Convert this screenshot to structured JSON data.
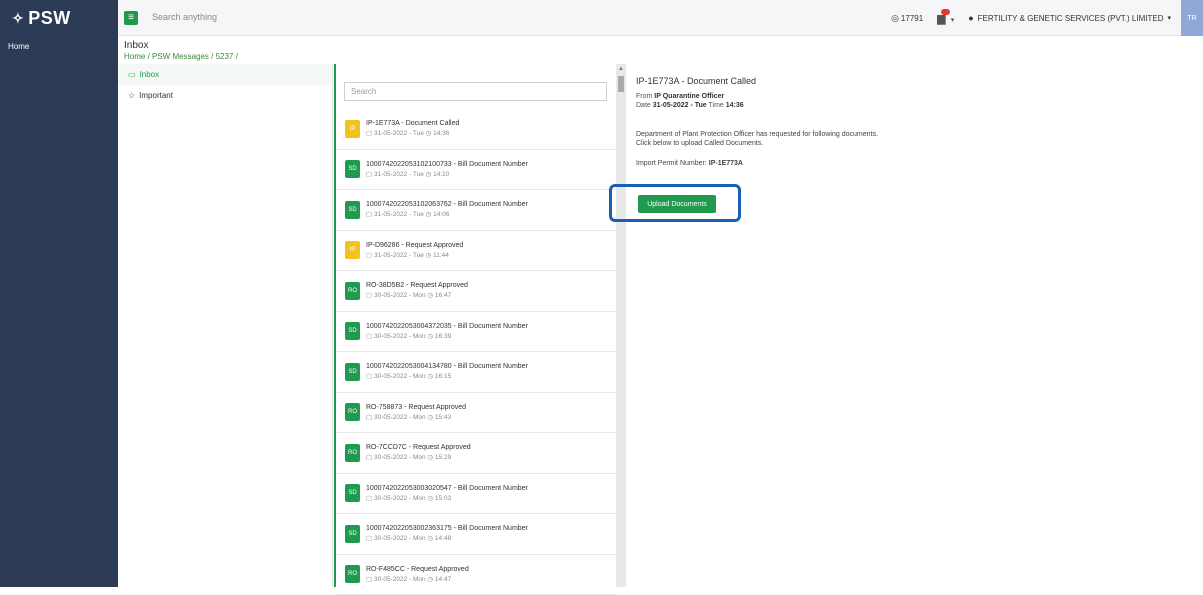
{
  "app": {
    "logo": "PSW",
    "logo_mark": "✧"
  },
  "topbar": {
    "search_placeholder": "Search anything",
    "counter": "17791",
    "company": "FERTILITY & GENETIC SERVICES (PVT.) LIMITED",
    "avatar": "TR"
  },
  "sidebar": {
    "home": "Home"
  },
  "header": {
    "title": "Inbox",
    "breadcrumb": "Home / PSW Messages / 5237 /"
  },
  "nav": [
    {
      "label": "Inbox",
      "icon": "inbox-icon"
    },
    {
      "label": "Important",
      "icon": "star-icon"
    }
  ],
  "messages_search_placeholder": "Search",
  "messages": [
    {
      "badge": "IP",
      "title": "IP-1E773A - Document Called",
      "date": "31-05-2022 - Tue",
      "time": "14:36"
    },
    {
      "badge": "SD",
      "title": "1000742022053102100733 - Bill Document Number",
      "date": "31-05-2022 - Tue",
      "time": "14:10"
    },
    {
      "badge": "SD",
      "title": "1000742022053102063762 - Bill Document Number",
      "date": "31-05-2022 - Tue",
      "time": "14:06"
    },
    {
      "badge": "IP",
      "title": "IP-D96286 - Request Approved",
      "date": "31-05-2022 - Tue",
      "time": "11:44"
    },
    {
      "badge": "RO",
      "title": "RO-38D5B2 - Request Approved",
      "date": "30-05-2022 - Mon",
      "time": "16:47"
    },
    {
      "badge": "SD",
      "title": "1000742022053004372035 - Bill Document Number",
      "date": "30-05-2022 - Mon",
      "time": "16:39"
    },
    {
      "badge": "SD",
      "title": "1000742022053004134780 - Bill Document Number",
      "date": "30-05-2022 - Mon",
      "time": "16:15"
    },
    {
      "badge": "RO",
      "title": "RO-758873 - Request Approved",
      "date": "30-05-2022 - Mon",
      "time": "15:43"
    },
    {
      "badge": "RO",
      "title": "RO-7CCD7C - Request Approved",
      "date": "30-05-2022 - Mon",
      "time": "15:29"
    },
    {
      "badge": "SD",
      "title": "1000742022053003020547 - Bill Document Number",
      "date": "30-05-2022 - Mon",
      "time": "15:03"
    },
    {
      "badge": "SD",
      "title": "1000742022053002363175 - Bill Document Number",
      "date": "30-05-2022 - Mon",
      "time": "14:48"
    },
    {
      "badge": "RO",
      "title": "RO-F485CC - Request Approved",
      "date": "30-05-2022 - Mon",
      "time": "14:47"
    }
  ],
  "detail": {
    "subject": "IP-1E773A - Document Called",
    "from_label": "From",
    "from": "IP Quarantine Officer",
    "date_label": "Date",
    "date": "31-05-2022 - Tue",
    "time_label": "Time",
    "time": "14:36",
    "body1": "Department of Plant Protection Officer has requested for following documents.",
    "body2": "Click below to upload Called Documents.",
    "permit_label": "Import Permit Number:",
    "permit": "IP-1E773A",
    "upload_button": "Upload Documents"
  },
  "colors": {
    "sidebar": "#2b3a55",
    "accent": "#1f9a4f",
    "highlight": "#1a5fb4",
    "ip_badge": "#f4c21a"
  }
}
